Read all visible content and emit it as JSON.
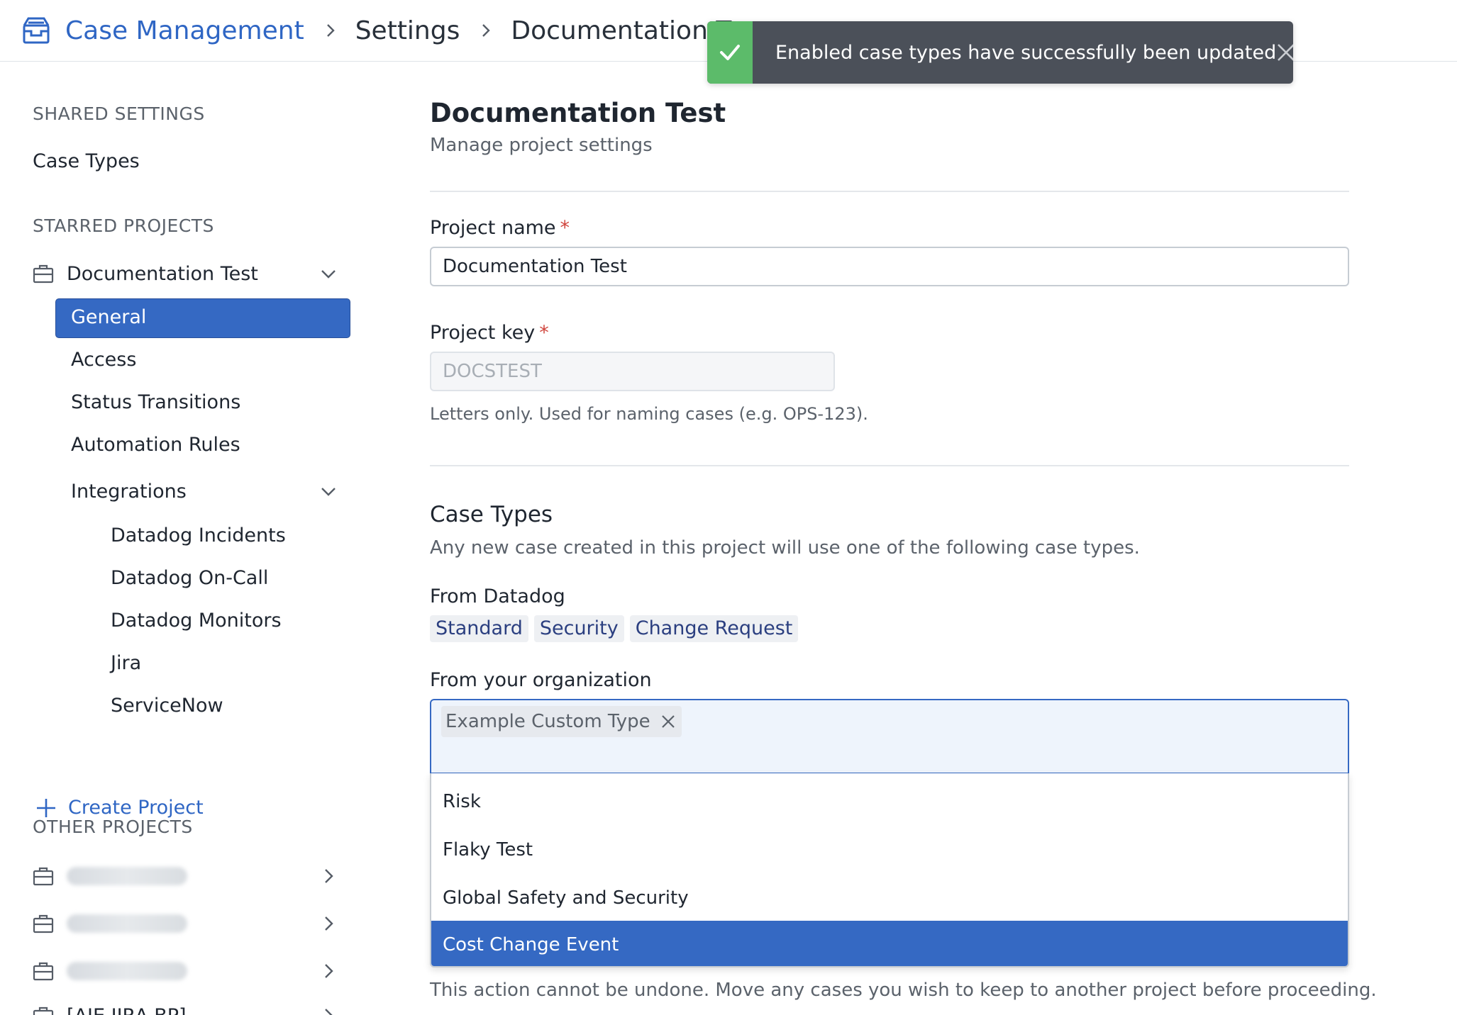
{
  "breadcrumb": {
    "app": "Case Management",
    "settings": "Settings",
    "project": "Documentation Tes"
  },
  "toast": {
    "message": "Enabled case types have successfully been updated",
    "status_color": "#5cbb6a",
    "icons": {
      "status": "check-icon",
      "close": "close-icon"
    }
  },
  "sidebar": {
    "shared_header": "SHARED SETTINGS",
    "case_types": "Case Types",
    "starred_header": "STARRED PROJECTS",
    "starred_project": "Documentation Test",
    "nav": {
      "general": "General",
      "access": "Access",
      "status_transitions": "Status Transitions",
      "automation_rules": "Automation Rules",
      "integrations": "Integrations"
    },
    "integrations": [
      "Datadog Incidents",
      "Datadog On-Call",
      "Datadog Monitors",
      "Jira",
      "ServiceNow"
    ],
    "create_project": "Create Project",
    "other_header": "OTHER PROJECTS",
    "other_partial": "[AIE JIRA BP]"
  },
  "main": {
    "title": "Documentation Test",
    "subtitle": "Manage project settings",
    "project_name_label": "Project name",
    "project_name_value": "Documentation Test",
    "project_key_label": "Project key",
    "project_key_value": "DOCSTEST",
    "project_key_help": "Letters only. Used for naming cases (e.g. OPS-123).",
    "required_mark": "*",
    "case_types_title": "Case Types",
    "case_types_subtitle": "Any new case created in this project will use one of the following case types.",
    "from_datadog_label": "From Datadog",
    "datadog_types": [
      "Standard",
      "Security",
      "Change Request"
    ],
    "from_org_label": "From your organization",
    "selected_chip": "Example Custom Type",
    "options": [
      "Risk",
      "Flaky Test",
      "Global Safety and Security",
      "Cost Change Event"
    ],
    "highlighted_option": "Cost Change Event",
    "warning": "This action cannot be undone. Move any cases you wish to keep to another project before proceeding."
  },
  "colors": {
    "accent": "#3569c3",
    "link": "#2f66c4",
    "required": "#d0453d"
  }
}
